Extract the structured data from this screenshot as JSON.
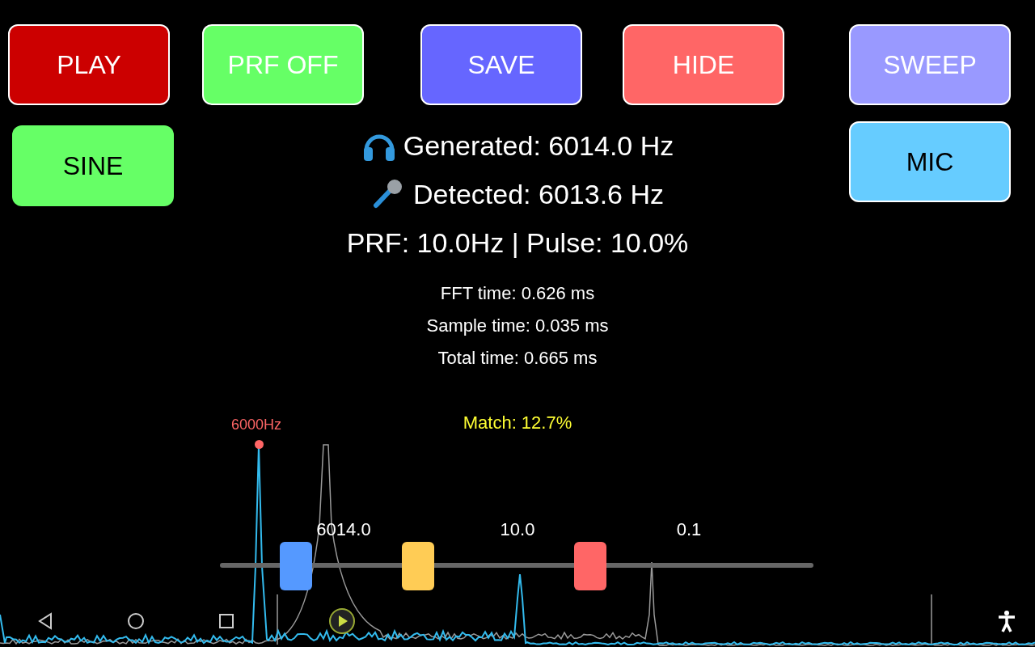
{
  "top_buttons": [
    {
      "label": "PLAY",
      "color": "#cc0000",
      "kind": "light"
    },
    {
      "label": "PRF OFF",
      "color": "#66ff66",
      "kind": "light"
    },
    {
      "label": "SAVE",
      "color": "#6666ff",
      "kind": "light"
    },
    {
      "label": "HIDE",
      "color": "#ff6666",
      "kind": "light"
    },
    {
      "label": "SWEEP",
      "color": "#9999ff",
      "kind": "light"
    }
  ],
  "left_button": {
    "label": "SINE",
    "color": "#66ff66",
    "kind": "dark"
  },
  "right_button": {
    "label": "MIC",
    "color": "#66ccff",
    "kind": "dark"
  },
  "generated": "Generated: 6014.0 Hz",
  "detected": "Detected: 6013.6 Hz",
  "prf_line": "PRF: 10.0Hz | Pulse: 10.0%",
  "timings": [
    "FFT time: 0.626 ms",
    "Sample time: 0.035 ms",
    "Total time: 0.665 ms"
  ],
  "match": "Match: 12.7%",
  "peak_label": "6000Hz",
  "sliders": [
    {
      "reading": "6014.0",
      "level": 0.128,
      "color": "#5599ff"
    },
    {
      "reading": "10.0",
      "level": 0.334,
      "color": "#ffcc55"
    },
    {
      "reading": "0.1",
      "level": 0.624,
      "color": "#ff6666"
    }
  ]
}
